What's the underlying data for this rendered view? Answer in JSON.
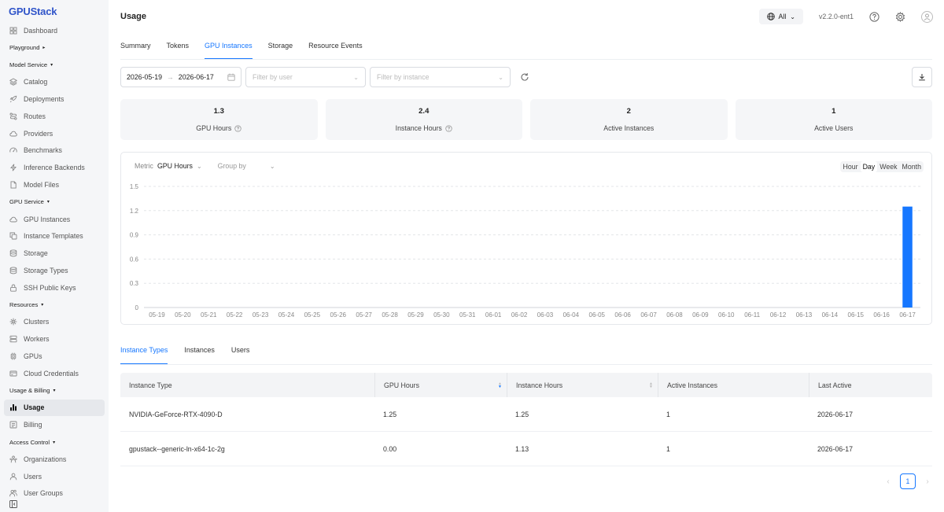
{
  "app": {
    "logo_text": "GPUStack"
  },
  "sidebar": {
    "items": [
      {
        "type": "item",
        "label": "Dashboard",
        "icon": "grid-icon"
      },
      {
        "type": "group",
        "label": "Playground",
        "arrow": "▸"
      },
      {
        "type": "group",
        "label": "Model Service",
        "arrow": "▾"
      },
      {
        "type": "item",
        "label": "Catalog",
        "icon": "layers-icon"
      },
      {
        "type": "item",
        "label": "Deployments",
        "icon": "rocket-icon"
      },
      {
        "type": "item",
        "label": "Routes",
        "icon": "route-icon"
      },
      {
        "type": "item",
        "label": "Providers",
        "icon": "cloud-icon"
      },
      {
        "type": "item",
        "label": "Benchmarks",
        "icon": "gauge-icon"
      },
      {
        "type": "item",
        "label": "Inference Backends",
        "icon": "bolt-icon"
      },
      {
        "type": "item",
        "label": "Model Files",
        "icon": "file-icon"
      },
      {
        "type": "group",
        "label": "GPU Service",
        "arrow": "▾"
      },
      {
        "type": "item",
        "label": "GPU Instances",
        "icon": "cloud-icon"
      },
      {
        "type": "item",
        "label": "Instance Templates",
        "icon": "copy-icon"
      },
      {
        "type": "item",
        "label": "Storage",
        "icon": "database-icon"
      },
      {
        "type": "item",
        "label": "Storage Types",
        "icon": "database-icon"
      },
      {
        "type": "item",
        "label": "SSH Public Keys",
        "icon": "lock-icon"
      },
      {
        "type": "group",
        "label": "Resources",
        "arrow": "▾"
      },
      {
        "type": "item",
        "label": "Clusters",
        "icon": "cluster-icon"
      },
      {
        "type": "item",
        "label": "Workers",
        "icon": "server-icon"
      },
      {
        "type": "item",
        "label": "GPUs",
        "icon": "chip-icon"
      },
      {
        "type": "item",
        "label": "Cloud Credentials",
        "icon": "key-icon"
      },
      {
        "type": "group",
        "label": "Usage & Billing",
        "arrow": "▾"
      },
      {
        "type": "item",
        "label": "Usage",
        "icon": "bar-chart-icon",
        "active": true
      },
      {
        "type": "item",
        "label": "Billing",
        "icon": "billing-icon"
      },
      {
        "type": "group",
        "label": "Access Control",
        "arrow": "▾"
      },
      {
        "type": "item",
        "label": "Organizations",
        "icon": "org-icon"
      },
      {
        "type": "item",
        "label": "Users",
        "icon": "user-icon"
      },
      {
        "type": "item",
        "label": "User Groups",
        "icon": "users-icon"
      }
    ]
  },
  "header": {
    "title": "Usage",
    "scope": "All",
    "version": "v2.2.0-ent1"
  },
  "tabs": [
    {
      "label": "Summary",
      "active": false
    },
    {
      "label": "Tokens",
      "active": false
    },
    {
      "label": "GPU Instances",
      "active": true
    },
    {
      "label": "Storage",
      "active": false
    },
    {
      "label": "Resource Events",
      "active": false
    }
  ],
  "filters": {
    "date_start": "2026-05-19",
    "date_end": "2026-06-17",
    "date_separator": "→",
    "user_placeholder": "Filter by user",
    "instance_placeholder": "Filter by instance"
  },
  "stats": [
    {
      "value": "1.3",
      "label": "GPU Hours",
      "help": true
    },
    {
      "value": "2.4",
      "label": "Instance Hours",
      "help": true
    },
    {
      "value": "2",
      "label": "Active Instances",
      "help": false
    },
    {
      "value": "1",
      "label": "Active Users",
      "help": false
    }
  ],
  "chart_controls": {
    "metric_label": "Metric",
    "metric_value": "GPU Hours",
    "group_by_placeholder": "Group by",
    "granularity": [
      {
        "label": "Hour",
        "active": false
      },
      {
        "label": "Day",
        "active": true
      },
      {
        "label": "Week",
        "active": false
      },
      {
        "label": "Month",
        "active": false
      }
    ]
  },
  "chart_data": {
    "type": "bar",
    "categories": [
      "05-19",
      "05-20",
      "05-21",
      "05-22",
      "05-23",
      "05-24",
      "05-25",
      "05-26",
      "05-27",
      "05-28",
      "05-29",
      "05-30",
      "05-31",
      "06-01",
      "06-02",
      "06-03",
      "06-04",
      "06-05",
      "06-06",
      "06-07",
      "06-08",
      "06-09",
      "06-10",
      "06-11",
      "06-12",
      "06-13",
      "06-14",
      "06-15",
      "06-16",
      "06-17"
    ],
    "values": [
      0,
      0,
      0,
      0,
      0,
      0,
      0,
      0,
      0,
      0,
      0,
      0,
      0,
      0,
      0,
      0,
      0,
      0,
      0,
      0,
      0,
      0,
      0,
      0,
      0,
      0,
      0,
      0,
      0,
      1.25
    ],
    "ylim": [
      0,
      1.5
    ],
    "yticks": [
      0,
      0.3,
      0.6,
      0.9,
      1.2,
      1.5
    ],
    "title": "",
    "xlabel": "",
    "ylabel": "",
    "grid": true,
    "color": "#1677ff"
  },
  "bottom_tabs": [
    {
      "label": "Instance Types",
      "active": true
    },
    {
      "label": "Instances",
      "active": false
    },
    {
      "label": "Users",
      "active": false
    }
  ],
  "table": {
    "columns": [
      "Instance Type",
      "GPU Hours",
      "Instance Hours",
      "Active Instances",
      "Last Active"
    ],
    "rows": [
      [
        "NVIDIA-GeForce-RTX-4090-D",
        "1.25",
        "1.25",
        "1",
        "2026-06-17"
      ],
      [
        "gpustack--generic-ln-x64-1c-2g",
        "0.00",
        "1.13",
        "1",
        "2026-06-17"
      ]
    ]
  },
  "pagination": {
    "current": "1"
  }
}
